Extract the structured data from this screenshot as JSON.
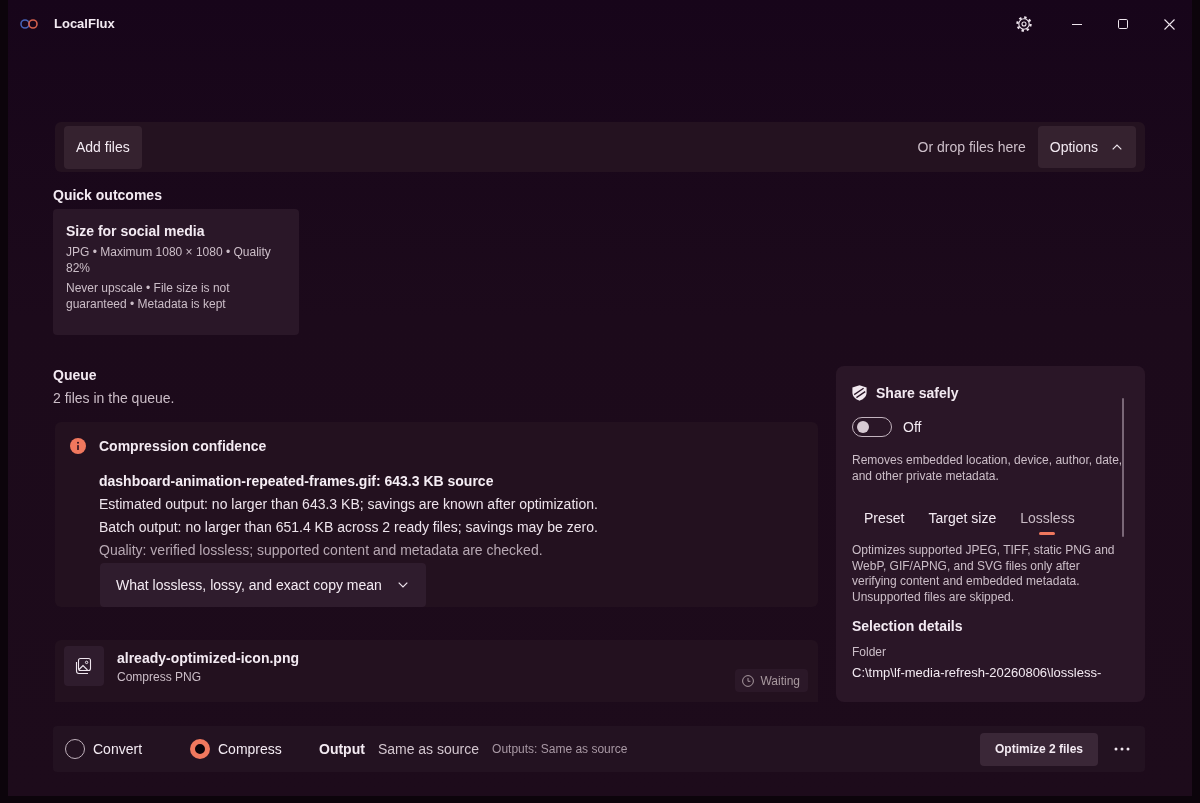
{
  "window": {
    "title": "LocalFlux"
  },
  "toolbar": {
    "add_button": "Add files",
    "drop_hint": "Or drop files here",
    "options_button": {
      "label": "Options",
      "expanded": true
    }
  },
  "quick_outcomes": {
    "heading": "Quick outcomes",
    "cards": [
      {
        "title": "Size for social media",
        "lines": [
          "JPG • Maximum 1080 × 1080 • Quality 82%",
          "Never upscale • File size is not guaranteed • Metadata is kept"
        ]
      }
    ]
  },
  "queue": {
    "heading": "Queue",
    "summary": "2 files in the queue.",
    "confidence": {
      "title": "Compression confidence",
      "lines": [
        {
          "kind": "heading",
          "text": "dashboard-animation-repeated-frames.gif: 643.3 KB source"
        },
        {
          "kind": "body",
          "text": "Estimated output: no larger than 643.3 KB; savings are known after optimization."
        },
        {
          "kind": "body",
          "text": "Batch output: no larger than 651.4 KB across 2 ready files; savings may be zero."
        },
        {
          "kind": "note",
          "text": "Quality: verified lossless; supported content and metadata are checked."
        }
      ],
      "expander": {
        "label": "What lossless, lossy, and exact copy mean",
        "expanded": false
      }
    },
    "files": [
      {
        "name": "already-optimized-icon.png",
        "action": "Compress PNG",
        "status": "Waiting"
      }
    ]
  },
  "share_panel": {
    "title": "Share safely",
    "toggle": {
      "on": false,
      "label": "Off"
    },
    "description": "Removes embedded location, device, author, date, and other private metadata.",
    "tabs": [
      {
        "label": "Preset",
        "selected": false
      },
      {
        "label": "Target size",
        "selected": false
      },
      {
        "label": "Lossless",
        "selected": true
      }
    ],
    "tab_description": "Optimizes supported JPEG, TIFF, static PNG and WebP, GIF/APNG, and SVG files only after verifying content and embedded metadata. Unsupported files are skipped.",
    "details": {
      "heading": "Selection details",
      "fields": [
        {
          "label": "Folder",
          "value": "C:\\tmp\\lf-media-refresh-20260806\\lossless-"
        }
      ]
    }
  },
  "bottom_bar": {
    "modes": [
      {
        "label": "Convert",
        "selected": false
      },
      {
        "label": "Compress",
        "selected": true
      }
    ],
    "output_label": "Output",
    "output_value": "Same as source",
    "outputs_note": "Outputs: Same as source",
    "primary_button": "Optimize 2 files"
  }
}
